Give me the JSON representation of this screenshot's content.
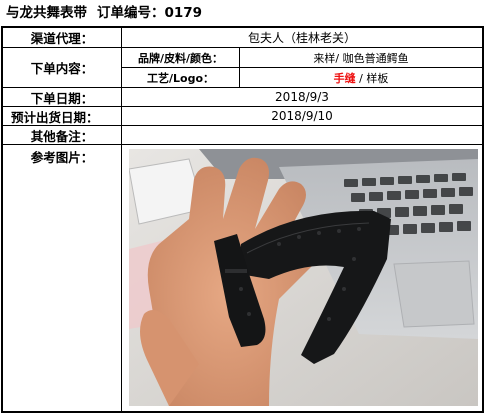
{
  "header": {
    "company": "与龙共舞表带",
    "order_label": "订单编号：",
    "order_number": "0179"
  },
  "rows": {
    "agent_label": "渠道代理：",
    "agent_value": "包夫人（桂林老关）",
    "content_label": "下单内容：",
    "brand_label": "品牌/皮料/颜色：",
    "brand_value": "来样/ 咖色普通鳄鱼",
    "craft_label": "工艺/Logo：",
    "craft_value_red": "手缝",
    "craft_value_rest": " / 样板",
    "order_date_label": "下单日期：",
    "order_date_value": "2018/9/3",
    "ship_date_label": "预计出货日期：",
    "ship_date_value": "2018/9/10",
    "notes_label": "其他备注：",
    "notes_value": "",
    "ref_label": "参考图片："
  },
  "colors": {
    "border": "#000000",
    "accent_red": "#ee1111"
  }
}
